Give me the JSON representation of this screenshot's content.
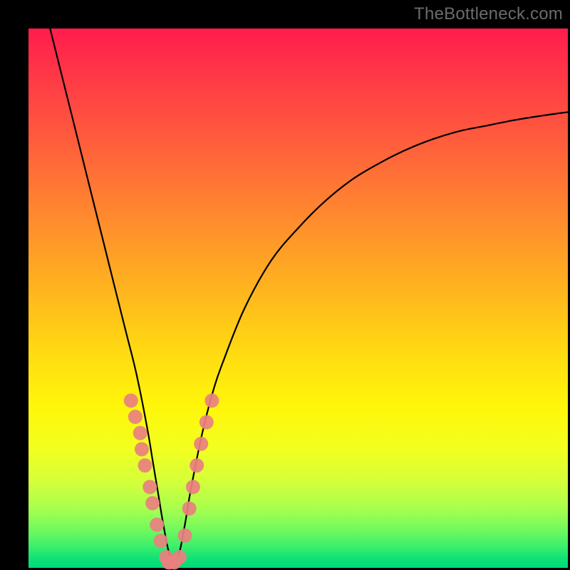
{
  "watermark": "TheBottleneck.com",
  "chart_data": {
    "type": "line",
    "title": "",
    "xlabel": "",
    "ylabel": "",
    "xlim": [
      0,
      100
    ],
    "ylim": [
      0,
      100
    ],
    "background_gradient": {
      "top": "#ff1c4d",
      "mid": "#ffe010",
      "bottom": "#00d97a"
    },
    "series": [
      {
        "name": "bottleneck-curve",
        "x": [
          4,
          6,
          8,
          10,
          12,
          14,
          16,
          18,
          20,
          22,
          23,
          24,
          25,
          26,
          27,
          28,
          29,
          30,
          32,
          34,
          36,
          40,
          45,
          50,
          55,
          60,
          65,
          70,
          75,
          80,
          85,
          90,
          95,
          100
        ],
        "y": [
          100,
          92,
          84,
          76,
          68,
          60,
          52,
          44,
          36,
          26,
          20,
          14,
          8,
          3,
          1,
          3,
          8,
          14,
          24,
          32,
          38,
          48,
          57,
          63,
          68,
          72,
          75,
          77.5,
          79.5,
          81,
          82,
          83,
          83.8,
          84.5
        ]
      }
    ],
    "scatter_points": {
      "name": "highlighted-points",
      "color": "#e98080",
      "points": [
        {
          "x": 19.0,
          "y": 31
        },
        {
          "x": 19.8,
          "y": 28
        },
        {
          "x": 20.7,
          "y": 25
        },
        {
          "x": 21.0,
          "y": 22
        },
        {
          "x": 21.6,
          "y": 19
        },
        {
          "x": 22.5,
          "y": 15
        },
        {
          "x": 23.0,
          "y": 12
        },
        {
          "x": 23.8,
          "y": 8
        },
        {
          "x": 24.5,
          "y": 5
        },
        {
          "x": 25.5,
          "y": 2
        },
        {
          "x": 26.0,
          "y": 1
        },
        {
          "x": 27.0,
          "y": 1
        },
        {
          "x": 28.0,
          "y": 2
        },
        {
          "x": 29.0,
          "y": 6
        },
        {
          "x": 29.8,
          "y": 11
        },
        {
          "x": 30.5,
          "y": 15
        },
        {
          "x": 31.2,
          "y": 19
        },
        {
          "x": 32.0,
          "y": 23
        },
        {
          "x": 33.0,
          "y": 27
        },
        {
          "x": 34.0,
          "y": 31
        }
      ]
    }
  }
}
